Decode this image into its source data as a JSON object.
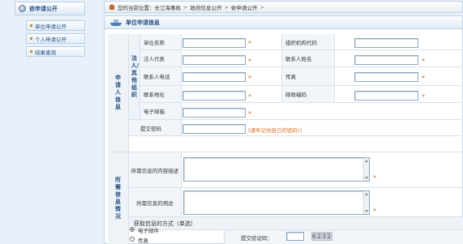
{
  "sidebar": {
    "title": "依申请公开",
    "items": [
      {
        "label": "单位申请公开"
      },
      {
        "label": "个人申请公开"
      },
      {
        "label": "结果查询"
      }
    ]
  },
  "breadcrumb": {
    "prefix": "您的当前位置：",
    "items": [
      "长江海事局",
      "政府信息公开",
      "依申请公开"
    ]
  },
  "panel": {
    "title": "单位申请信息"
  },
  "form": {
    "section_applicant": "申请人信息",
    "group_legal": "法人/其他组织",
    "section_info": "所需信息情况",
    "fields": {
      "unit_name": "单位名称",
      "org_code": "组织机构代码",
      "legal_rep": "法人代表",
      "contact_name": "联系人姓名",
      "contact_phone": "联系人电话",
      "fax": "传真",
      "contact_addr": "联系地址",
      "postcode": "邮政编码",
      "email": "电子邮箱",
      "submit_pwd": "提交密码",
      "content_desc": "所需信息的内容描述",
      "usage": "所需信息的用途",
      "obtain_method": "获取信息的方式（单选）",
      "captcha_label": "提交验证码："
    },
    "required_mark": "*",
    "pwd_hint": "(请牢记你自己的密码!)",
    "options": [
      {
        "label": "电子邮件",
        "checked": true
      },
      {
        "label": "传真",
        "checked": false
      }
    ],
    "captcha_value": "6232"
  }
}
